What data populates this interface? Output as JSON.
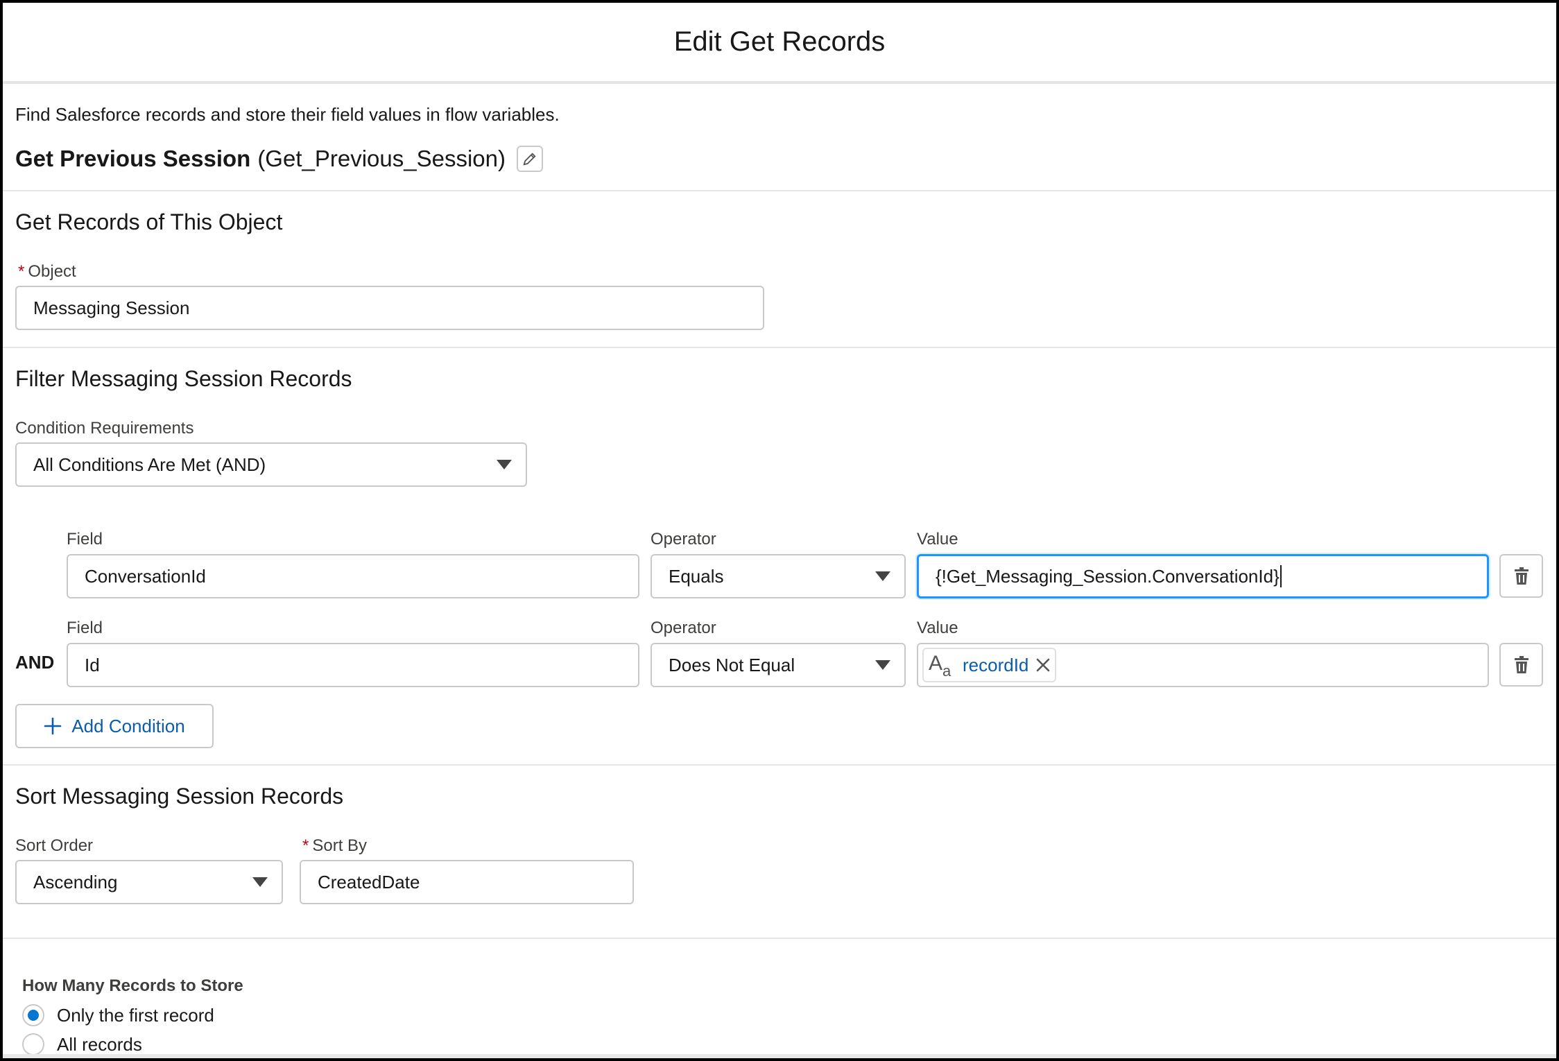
{
  "modal": {
    "title": "Edit Get Records"
  },
  "intro": {
    "description": "Find Salesforce records and store their field values in flow variables.",
    "element_label": "Get Previous Session",
    "element_api_name": "(Get_Previous_Session)"
  },
  "object_section": {
    "title": "Get Records of This Object",
    "object_label": "Object",
    "object_value": "Messaging Session"
  },
  "filter_section": {
    "title": "Filter Messaging Session Records",
    "requirements_label": "Condition Requirements",
    "requirements_value": "All Conditions Are Met (AND)",
    "logic_word": "AND",
    "field_label": "Field",
    "operator_label": "Operator",
    "value_label": "Value",
    "conditions": [
      {
        "field": "ConversationId",
        "operator": "Equals",
        "value": "{!Get_Messaging_Session.ConversationId}"
      },
      {
        "field": "Id",
        "operator": "Does Not Equal",
        "value_pill": "recordId",
        "value_type_icon": "text-type-icon"
      }
    ],
    "add_condition_label": "Add Condition"
  },
  "sort_section": {
    "title": "Sort Messaging Session Records",
    "sort_order_label": "Sort Order",
    "sort_order_value": "Ascending",
    "sort_by_label": "Sort By",
    "sort_by_value": "CreatedDate"
  },
  "store_section": {
    "title": "How Many Records to Store",
    "options": [
      {
        "label": "Only the first record",
        "selected": true
      },
      {
        "label": "All records",
        "selected": false
      }
    ]
  },
  "colors": {
    "brand_blue": "#0176d3",
    "link_blue": "#0b5cab",
    "focus_blue": "#1b96ff",
    "required_red": "#ba0517"
  }
}
